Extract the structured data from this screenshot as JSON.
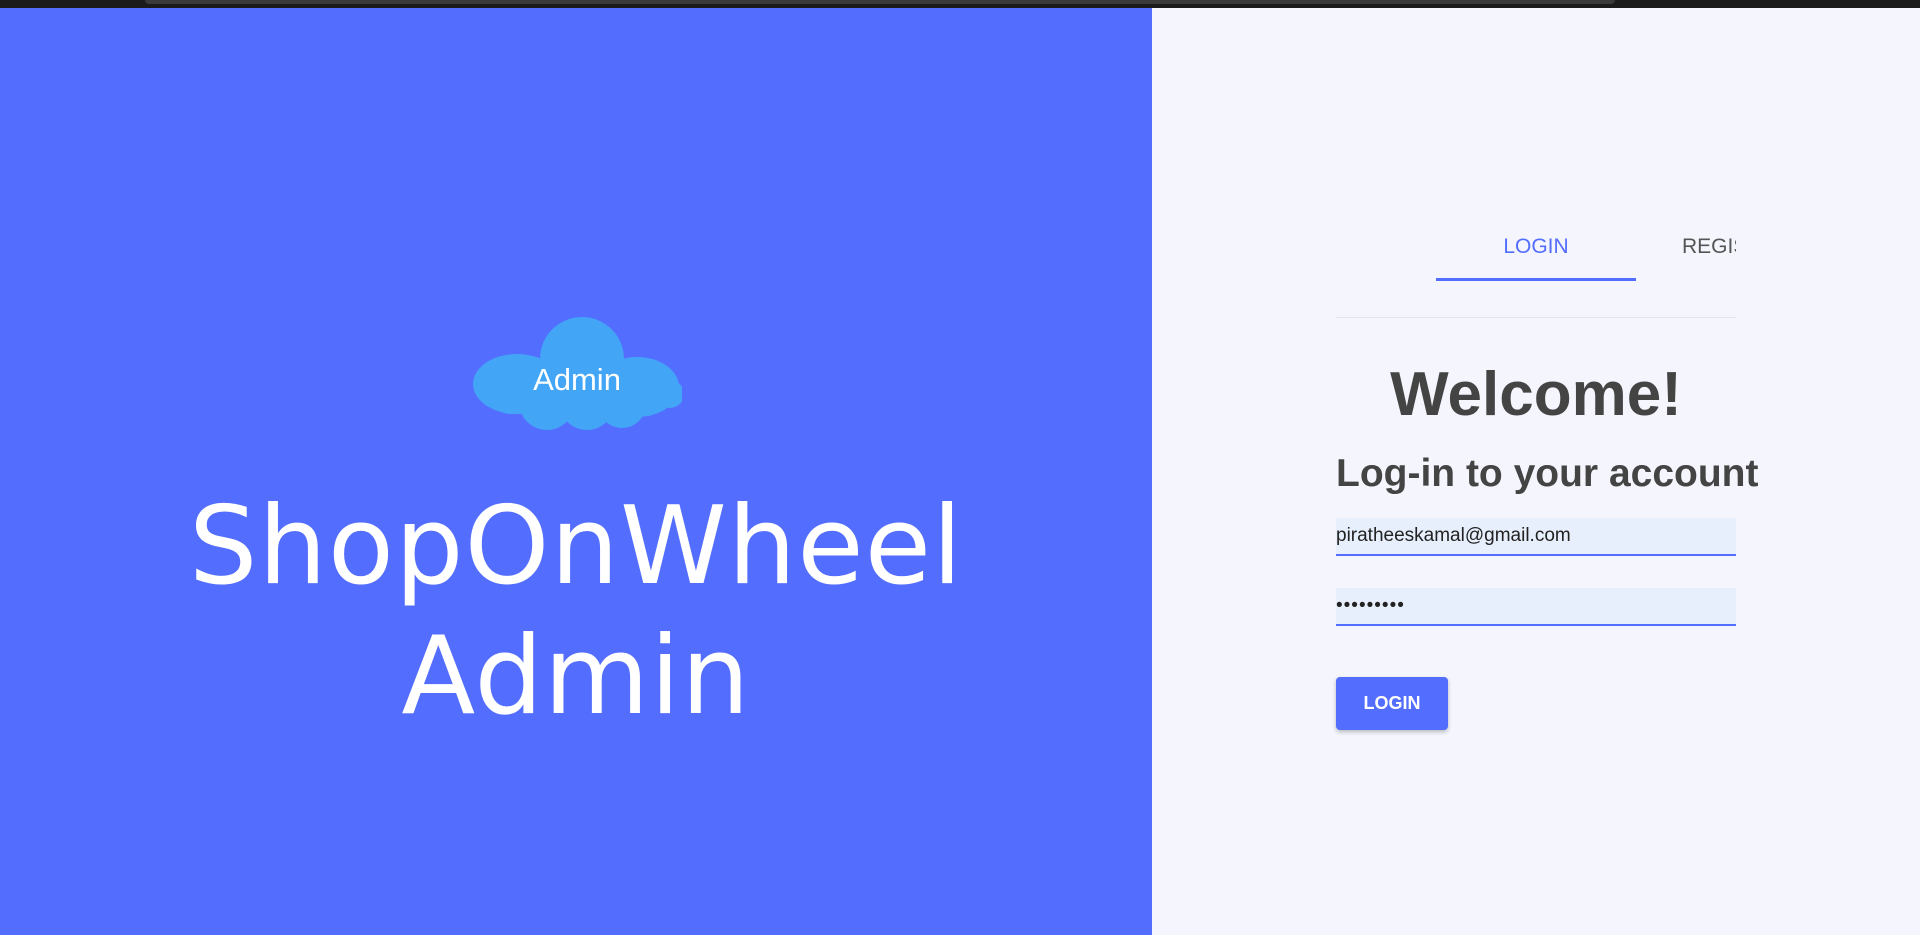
{
  "branding": {
    "cloud_badge_label": "Admin",
    "title": "ShopOnWheel Admin"
  },
  "tabs": {
    "login_label": "LOGIN",
    "register_label": "REGISTER",
    "active": "LOGIN"
  },
  "login_form": {
    "heading": "Welcome!",
    "subheading": "Log-in to your account",
    "email_value": "piratheeskamal@gmail.com",
    "password_masked": "•••••••••",
    "submit_label": "LOGIN"
  },
  "colors": {
    "primary": "#536dfe",
    "cloud": "#42a5f5",
    "right_panel_bg": "#f5f6fd",
    "input_bg": "#e8effc",
    "heading_text": "#444444"
  },
  "icons": {
    "cloud": "cloud-icon"
  }
}
